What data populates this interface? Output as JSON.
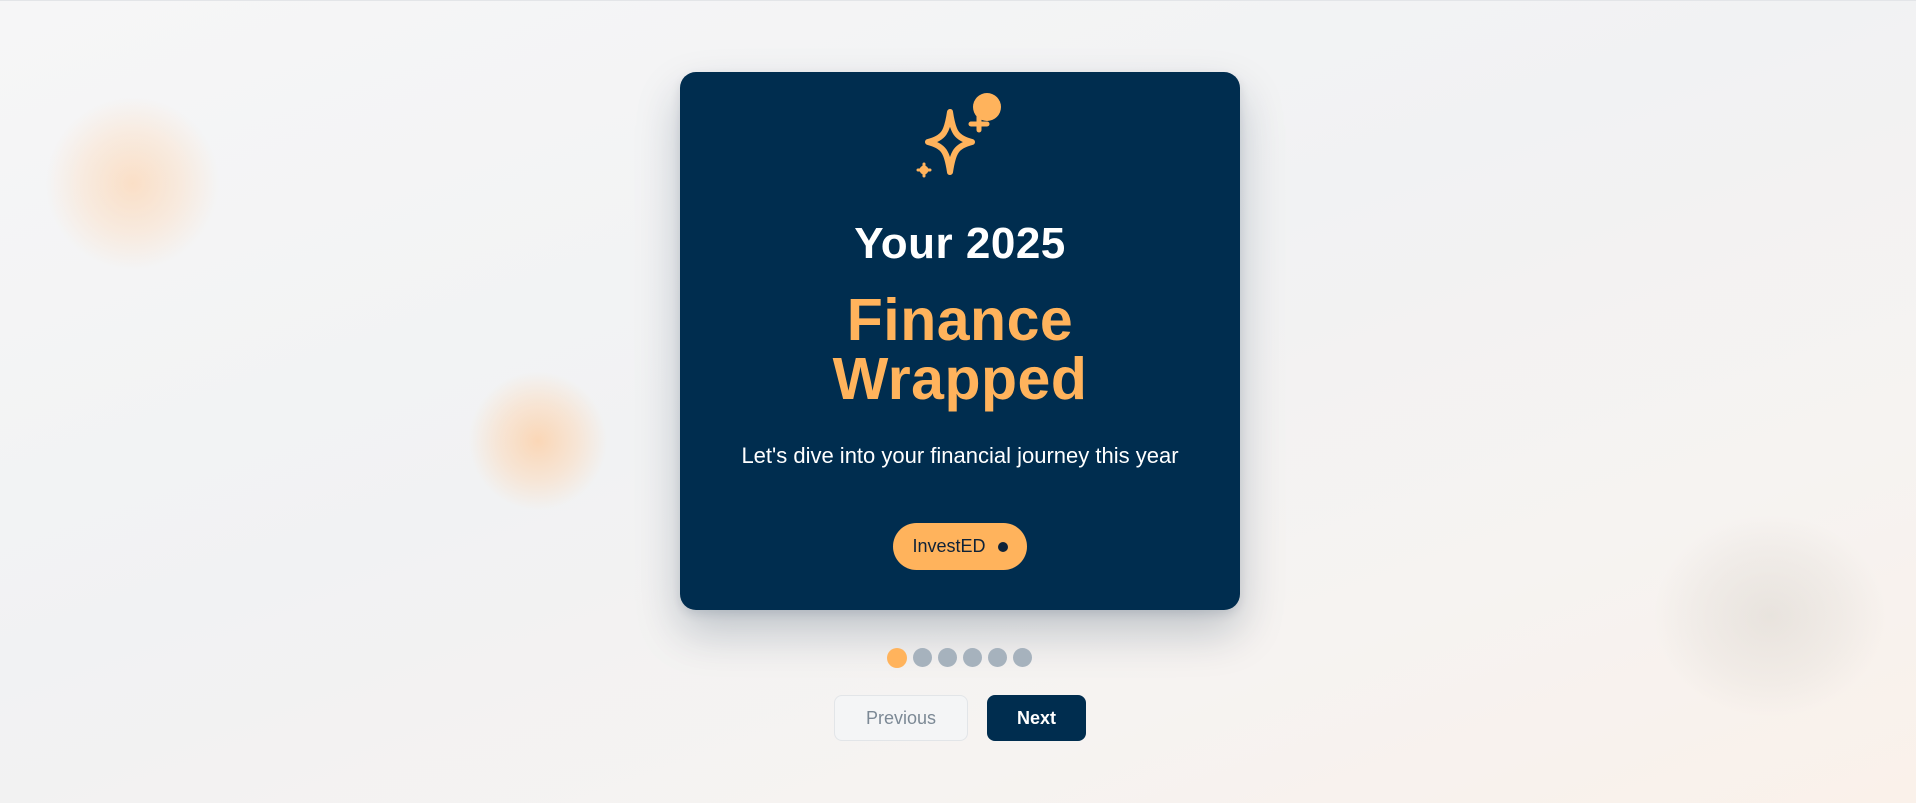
{
  "card": {
    "icon": "sparkle-icon",
    "title": "Your 2025",
    "headline_line1": "Finance",
    "headline_line2": "Wrapped",
    "subtitle": "Let's dive into your financial journey this year",
    "brand_label": "InvestED"
  },
  "pager": {
    "total_slides": 6,
    "current_slide": 1
  },
  "navigation": {
    "previous_label": "Previous",
    "next_label": "Next"
  },
  "colors": {
    "card_background": "#002d4f",
    "accent": "#ffb35c",
    "dot_inactive": "#a6b2bd",
    "text_light": "#ffffff"
  }
}
